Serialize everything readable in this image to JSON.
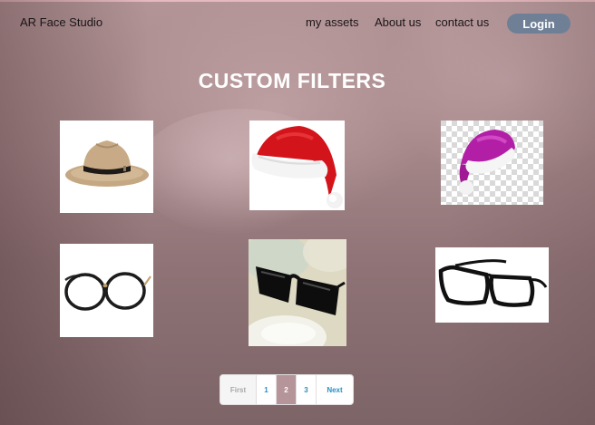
{
  "header": {
    "brand": "AR Face Studio",
    "nav": [
      {
        "label": "my assets"
      },
      {
        "label": "About us"
      },
      {
        "label": "contact us"
      }
    ],
    "login_label": "Login"
  },
  "main": {
    "title": "CUSTOM FILTERS",
    "filters": [
      {
        "icon": "fedora-hat-icon"
      },
      {
        "icon": "santa-hat-icon"
      },
      {
        "icon": "purple-santa-hat-icon"
      },
      {
        "icon": "round-glasses-icon"
      },
      {
        "icon": "sunglasses-icon"
      },
      {
        "icon": "rectangular-glasses-icon"
      }
    ]
  },
  "pagination": {
    "first": "First",
    "pages": [
      "1",
      "2",
      "3"
    ],
    "current": "2",
    "next": "Next"
  },
  "colors": {
    "login_button": "#6f8096",
    "active_page": "#b59599",
    "page_link": "#2b8fc0"
  }
}
